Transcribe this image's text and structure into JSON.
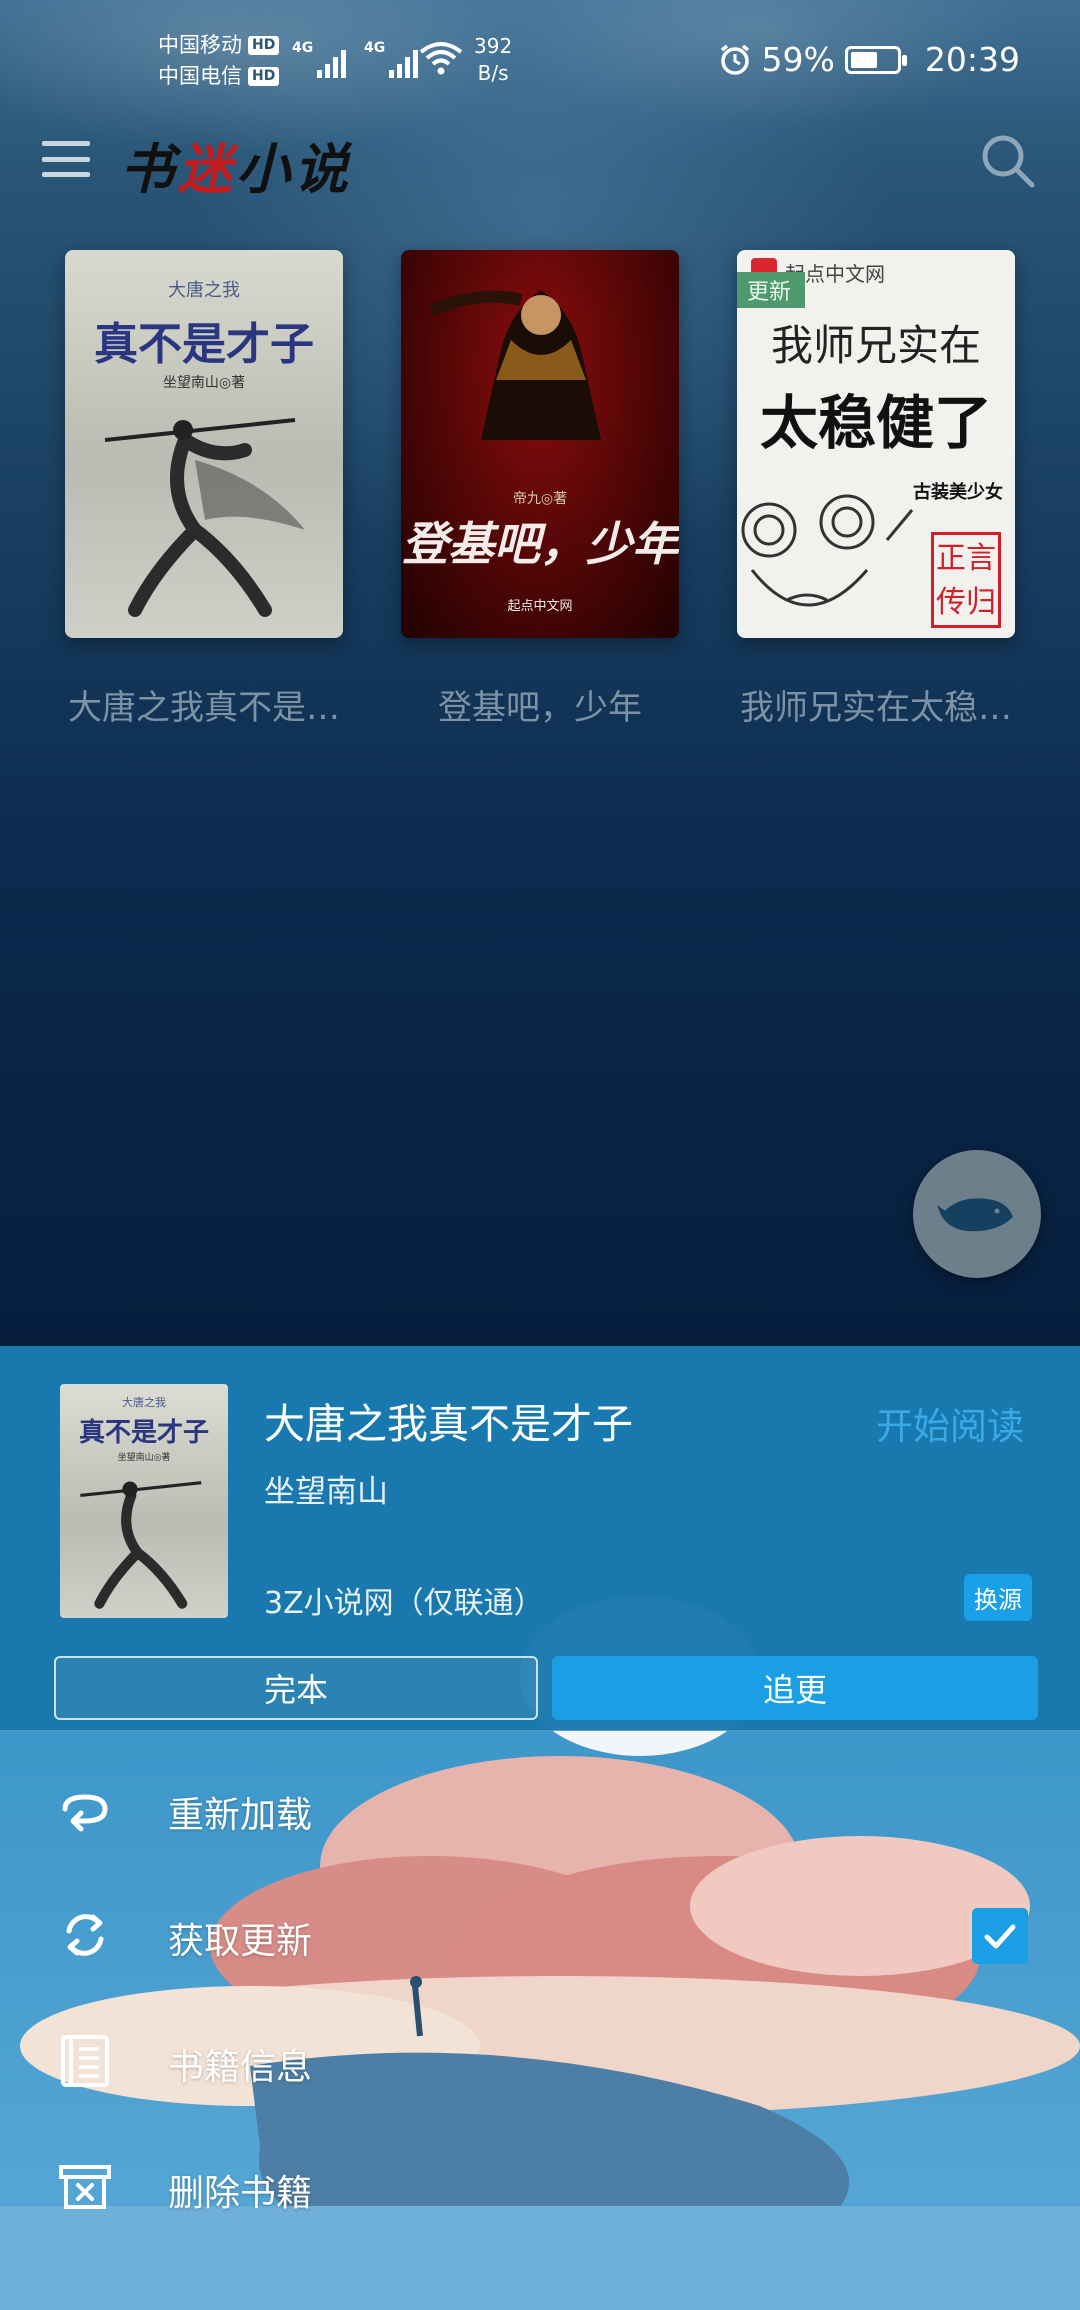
{
  "status_bar": {
    "carrier1": "中国移动",
    "carrier2": "中国电信",
    "hd_label": "HD",
    "network1": "4G",
    "network2": "4G",
    "net_speed_value": "392",
    "net_speed_unit": "B/s",
    "battery_percent": "59%",
    "battery_level": 0.59,
    "time": "20:39"
  },
  "app_bar": {
    "logo_part1": "书",
    "logo_part2": "迷",
    "logo_part3": "小说",
    "menu_icon": "hamburger-menu-icon",
    "search_icon": "search-icon"
  },
  "bookshelf": {
    "books": [
      {
        "title": "大唐之我真不是…",
        "cover_series": "大唐之我",
        "cover_title": "真不是才子",
        "cover_author": "坐望南山◎著"
      },
      {
        "title": "登基吧，少年",
        "cover_author": "帝九◎著",
        "cover_title": "登基吧，少年",
        "cover_publisher": "起点中文网"
      },
      {
        "title": "我师兄实在太稳…",
        "cover_publisher": "起点中文网",
        "update_tag": "更新",
        "cover_title_line1": "我师兄实在",
        "cover_title_line2": "太稳健了",
        "cover_author": "古装美少女",
        "cover_seal": "正言传归"
      }
    ]
  },
  "fab": {
    "icon": "whale-icon"
  },
  "sheet": {
    "book_title": "大唐之我真不是才子",
    "author": "坐望南山",
    "source": "3Z小说网（仅联通）",
    "start_reading": "开始阅读",
    "change_source": "换源",
    "tab_finished": "完本",
    "tab_follow": "追更",
    "cover_series": "大唐之我",
    "cover_title": "真不是才子",
    "cover_author": "坐望南山◎著",
    "actions": [
      {
        "label": "重新加载",
        "icon": "reload-icon"
      },
      {
        "label": "获取更新",
        "icon": "sync-icon",
        "checked": true
      },
      {
        "label": "书籍信息",
        "icon": "book-info-icon"
      },
      {
        "label": "删除书籍",
        "icon": "delete-box-icon"
      }
    ]
  },
  "colors": {
    "accent": "#1a9fe4",
    "sheet_bg": "#1878ad",
    "title_muted": "#7d92a5",
    "logo_red": "#c41c1c"
  }
}
